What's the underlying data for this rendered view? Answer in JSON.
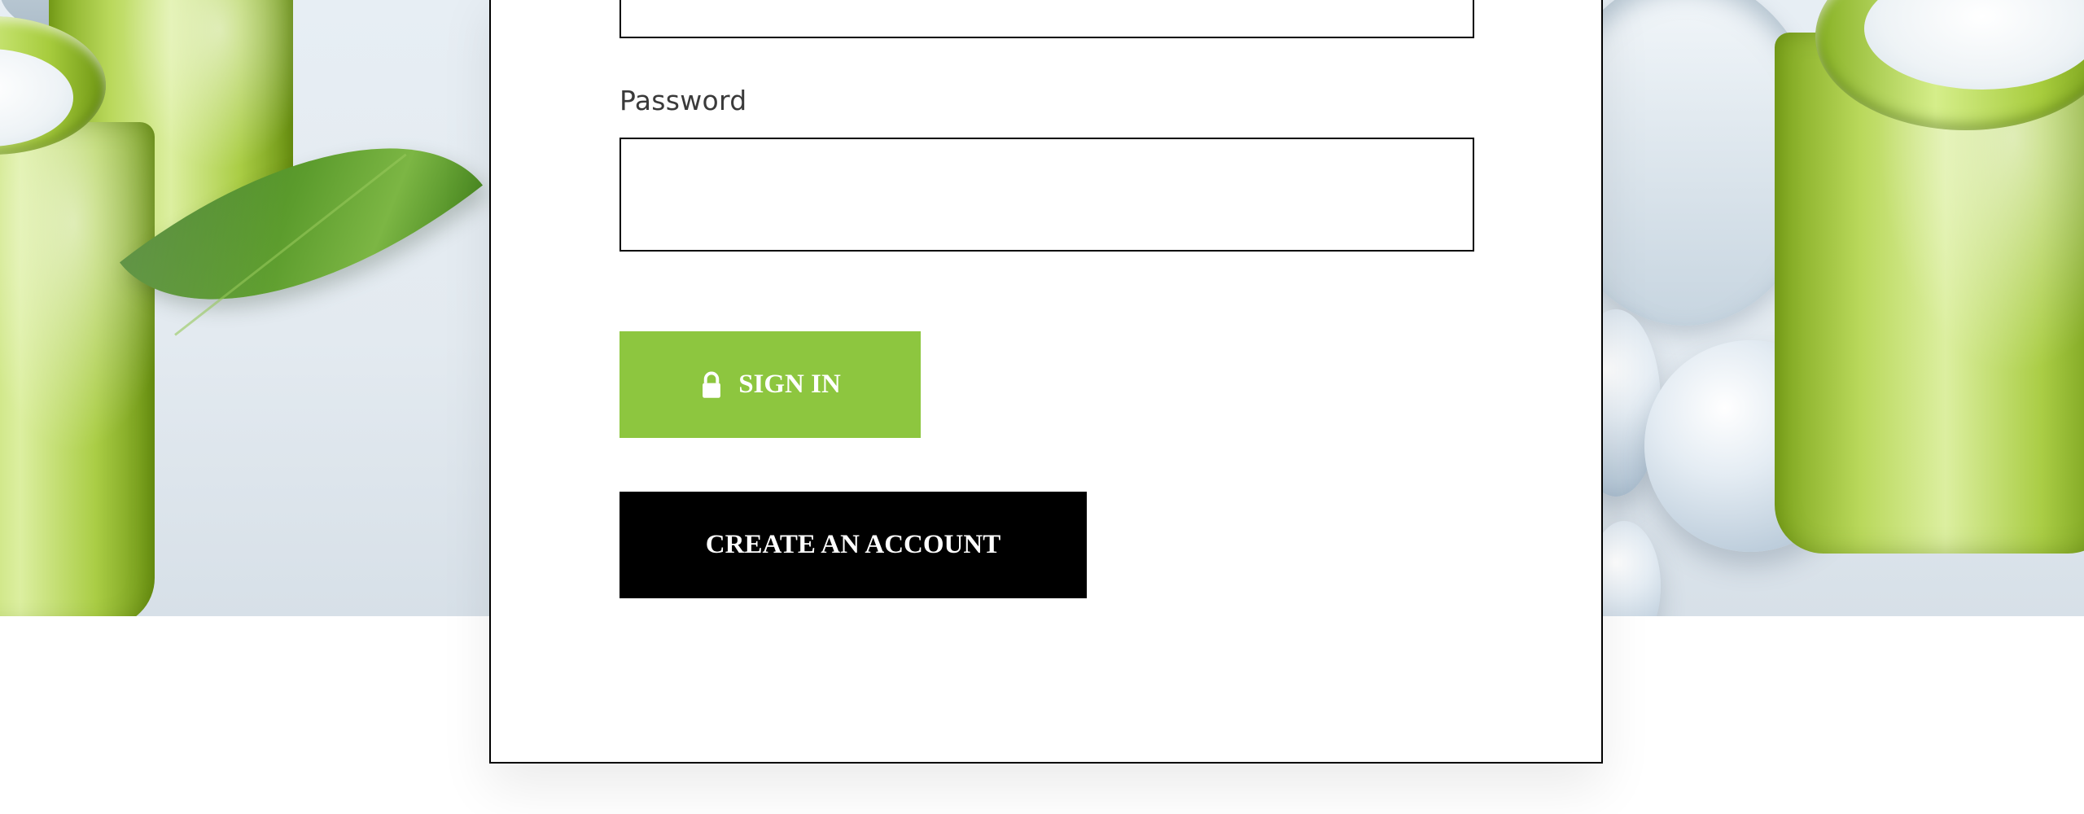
{
  "login_form": {
    "password_label": "Password",
    "email_value": "",
    "password_value": ""
  },
  "buttons": {
    "sign_in": "SIGN IN",
    "sign_in_icon": "lock-icon",
    "create_account": "CREATE AN ACCOUNT"
  },
  "colors": {
    "sign_in_bg": "#8dc63f",
    "create_account_bg": "#000000",
    "button_text": "#ffffff"
  }
}
